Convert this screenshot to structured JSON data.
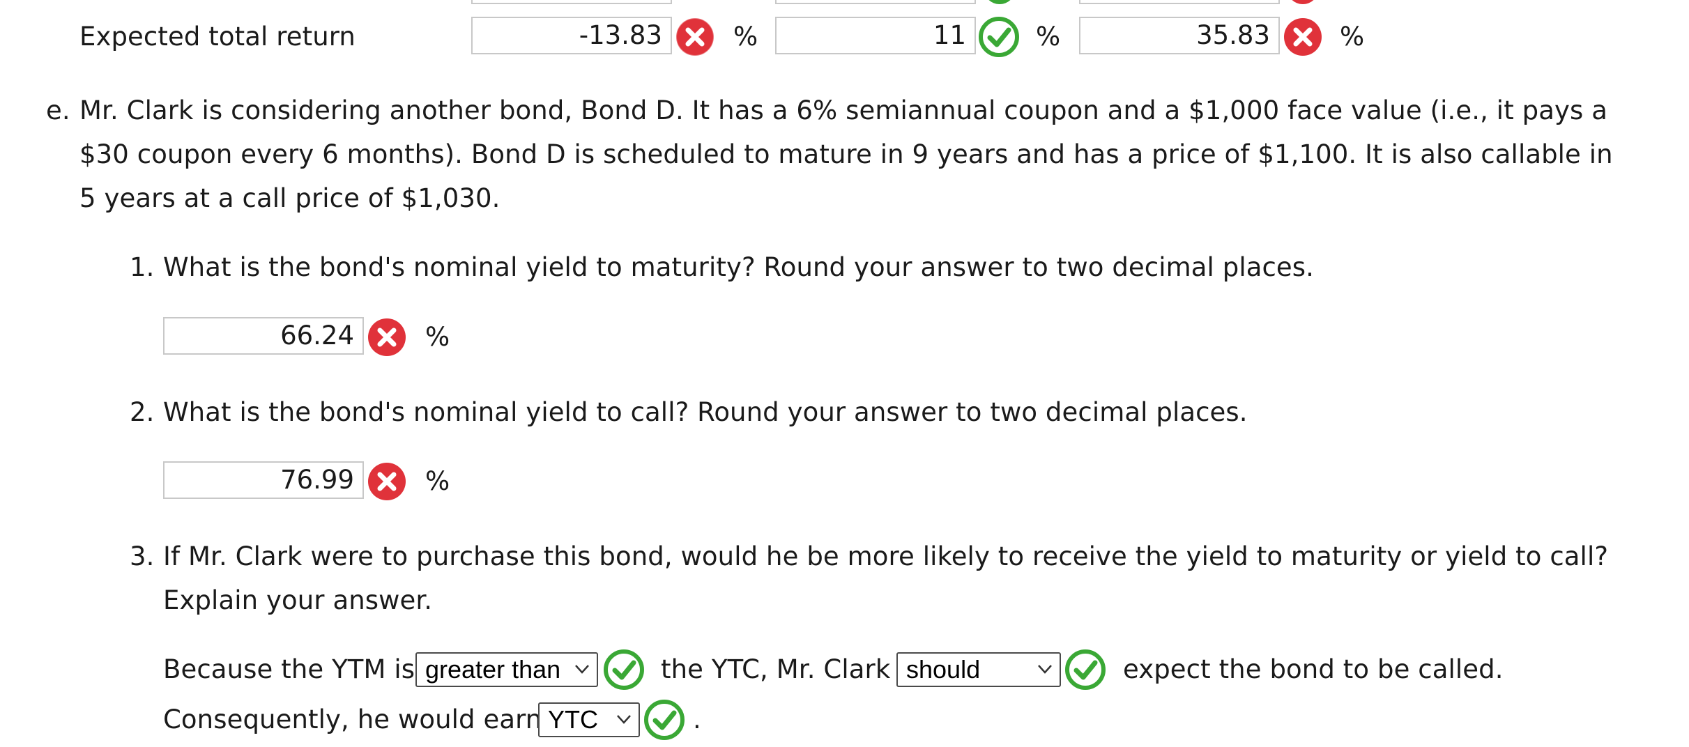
{
  "prev_row": {
    "label": "Expected total return",
    "answers": [
      {
        "value": "-13.83",
        "status": "incorrect",
        "unit": "%"
      },
      {
        "value": "11",
        "status": "correct",
        "unit": "%"
      },
      {
        "value": "35.83",
        "status": "incorrect",
        "unit": "%"
      }
    ]
  },
  "part_e": {
    "marker": "e.",
    "line1": "Mr. Clark is considering another bond, Bond D. It has a 6% semiannual coupon and a $1,000 face value (i.e., it pays a",
    "line2": "$30 coupon every 6 months). Bond D is scheduled to mature in 9 years and has a price of $1,100. It is also callable in",
    "line3": "5 years at a call price of $1,030."
  },
  "questions": [
    {
      "number": "1.",
      "text": "What is the bond's nominal yield to maturity? Round your answer to two decimal places.",
      "answer": "66.24",
      "status": "incorrect",
      "unit": "%"
    },
    {
      "number": "2.",
      "text": "What is the bond's nominal yield to call? Round your answer to two decimal places.",
      "answer": "76.99",
      "status": "incorrect",
      "unit": "%"
    },
    {
      "number": "3.",
      "text_line1": "If Mr. Clark were to purchase this bond, would he be more likely to receive the yield to maturity or yield to call?",
      "text_line2": "Explain your answer."
    }
  ],
  "explanation": {
    "segment1": "Because the YTM is",
    "select1": {
      "value": "greater than",
      "status": "correct"
    },
    "segment2": "the YTC, Mr. Clark",
    "select2": {
      "value": "should",
      "status": "correct"
    },
    "segment3": "expect the bond to be called.",
    "segment4": "Consequently, he would earn",
    "select3": {
      "value": "YTC",
      "status": "correct"
    },
    "segment5": "."
  },
  "icons": {
    "incorrect": "x-circle-icon",
    "correct": "check-circle-icon"
  },
  "colors": {
    "incorrect_red": "#e0323a",
    "correct_green": "#3aa835",
    "input_border": "#c8c8c8",
    "select_border": "#4a4a4a"
  }
}
